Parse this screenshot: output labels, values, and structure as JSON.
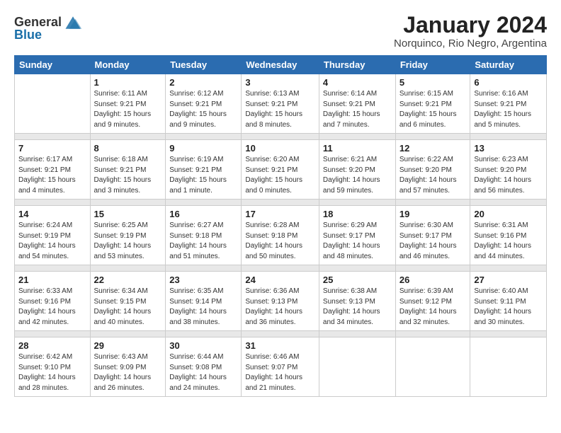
{
  "logo": {
    "text_general": "General",
    "text_blue": "Blue"
  },
  "title": "January 2024",
  "subtitle": "Norquinco, Rio Negro, Argentina",
  "days_of_week": [
    "Sunday",
    "Monday",
    "Tuesday",
    "Wednesday",
    "Thursday",
    "Friday",
    "Saturday"
  ],
  "weeks": [
    [
      {
        "day": "",
        "info": ""
      },
      {
        "day": "1",
        "info": "Sunrise: 6:11 AM\nSunset: 9:21 PM\nDaylight: 15 hours\nand 9 minutes."
      },
      {
        "day": "2",
        "info": "Sunrise: 6:12 AM\nSunset: 9:21 PM\nDaylight: 15 hours\nand 9 minutes."
      },
      {
        "day": "3",
        "info": "Sunrise: 6:13 AM\nSunset: 9:21 PM\nDaylight: 15 hours\nand 8 minutes."
      },
      {
        "day": "4",
        "info": "Sunrise: 6:14 AM\nSunset: 9:21 PM\nDaylight: 15 hours\nand 7 minutes."
      },
      {
        "day": "5",
        "info": "Sunrise: 6:15 AM\nSunset: 9:21 PM\nDaylight: 15 hours\nand 6 minutes."
      },
      {
        "day": "6",
        "info": "Sunrise: 6:16 AM\nSunset: 9:21 PM\nDaylight: 15 hours\nand 5 minutes."
      }
    ],
    [
      {
        "day": "7",
        "info": "Sunrise: 6:17 AM\nSunset: 9:21 PM\nDaylight: 15 hours\nand 4 minutes."
      },
      {
        "day": "8",
        "info": "Sunrise: 6:18 AM\nSunset: 9:21 PM\nDaylight: 15 hours\nand 3 minutes."
      },
      {
        "day": "9",
        "info": "Sunrise: 6:19 AM\nSunset: 9:21 PM\nDaylight: 15 hours\nand 1 minute."
      },
      {
        "day": "10",
        "info": "Sunrise: 6:20 AM\nSunset: 9:21 PM\nDaylight: 15 hours\nand 0 minutes."
      },
      {
        "day": "11",
        "info": "Sunrise: 6:21 AM\nSunset: 9:20 PM\nDaylight: 14 hours\nand 59 minutes."
      },
      {
        "day": "12",
        "info": "Sunrise: 6:22 AM\nSunset: 9:20 PM\nDaylight: 14 hours\nand 57 minutes."
      },
      {
        "day": "13",
        "info": "Sunrise: 6:23 AM\nSunset: 9:20 PM\nDaylight: 14 hours\nand 56 minutes."
      }
    ],
    [
      {
        "day": "14",
        "info": "Sunrise: 6:24 AM\nSunset: 9:19 PM\nDaylight: 14 hours\nand 54 minutes."
      },
      {
        "day": "15",
        "info": "Sunrise: 6:25 AM\nSunset: 9:19 PM\nDaylight: 14 hours\nand 53 minutes."
      },
      {
        "day": "16",
        "info": "Sunrise: 6:27 AM\nSunset: 9:18 PM\nDaylight: 14 hours\nand 51 minutes."
      },
      {
        "day": "17",
        "info": "Sunrise: 6:28 AM\nSunset: 9:18 PM\nDaylight: 14 hours\nand 50 minutes."
      },
      {
        "day": "18",
        "info": "Sunrise: 6:29 AM\nSunset: 9:17 PM\nDaylight: 14 hours\nand 48 minutes."
      },
      {
        "day": "19",
        "info": "Sunrise: 6:30 AM\nSunset: 9:17 PM\nDaylight: 14 hours\nand 46 minutes."
      },
      {
        "day": "20",
        "info": "Sunrise: 6:31 AM\nSunset: 9:16 PM\nDaylight: 14 hours\nand 44 minutes."
      }
    ],
    [
      {
        "day": "21",
        "info": "Sunrise: 6:33 AM\nSunset: 9:16 PM\nDaylight: 14 hours\nand 42 minutes."
      },
      {
        "day": "22",
        "info": "Sunrise: 6:34 AM\nSunset: 9:15 PM\nDaylight: 14 hours\nand 40 minutes."
      },
      {
        "day": "23",
        "info": "Sunrise: 6:35 AM\nSunset: 9:14 PM\nDaylight: 14 hours\nand 38 minutes."
      },
      {
        "day": "24",
        "info": "Sunrise: 6:36 AM\nSunset: 9:13 PM\nDaylight: 14 hours\nand 36 minutes."
      },
      {
        "day": "25",
        "info": "Sunrise: 6:38 AM\nSunset: 9:13 PM\nDaylight: 14 hours\nand 34 minutes."
      },
      {
        "day": "26",
        "info": "Sunrise: 6:39 AM\nSunset: 9:12 PM\nDaylight: 14 hours\nand 32 minutes."
      },
      {
        "day": "27",
        "info": "Sunrise: 6:40 AM\nSunset: 9:11 PM\nDaylight: 14 hours\nand 30 minutes."
      }
    ],
    [
      {
        "day": "28",
        "info": "Sunrise: 6:42 AM\nSunset: 9:10 PM\nDaylight: 14 hours\nand 28 minutes."
      },
      {
        "day": "29",
        "info": "Sunrise: 6:43 AM\nSunset: 9:09 PM\nDaylight: 14 hours\nand 26 minutes."
      },
      {
        "day": "30",
        "info": "Sunrise: 6:44 AM\nSunset: 9:08 PM\nDaylight: 14 hours\nand 24 minutes."
      },
      {
        "day": "31",
        "info": "Sunrise: 6:46 AM\nSunset: 9:07 PM\nDaylight: 14 hours\nand 21 minutes."
      },
      {
        "day": "",
        "info": ""
      },
      {
        "day": "",
        "info": ""
      },
      {
        "day": "",
        "info": ""
      }
    ]
  ]
}
